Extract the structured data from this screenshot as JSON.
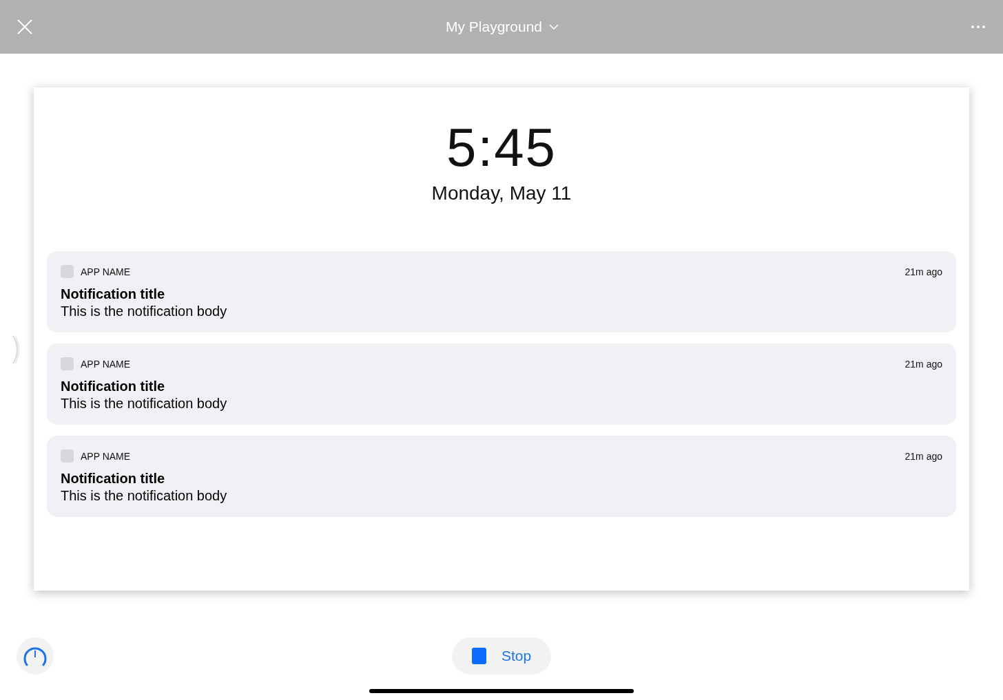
{
  "header": {
    "title": "My Playground"
  },
  "lock_screen": {
    "time": "5:45",
    "date": "Monday, May 11",
    "notifications": [
      {
        "app_name": "APP NAME",
        "time": "21m ago",
        "title": "Notification title",
        "body": "This is the notification body"
      },
      {
        "app_name": "APP NAME",
        "time": "21m ago",
        "title": "Notification title",
        "body": "This is the notification body"
      },
      {
        "app_name": "APP NAME",
        "time": "21m ago",
        "title": "Notification title",
        "body": "This is the notification body"
      }
    ]
  },
  "stop_button": {
    "label": "Stop"
  }
}
